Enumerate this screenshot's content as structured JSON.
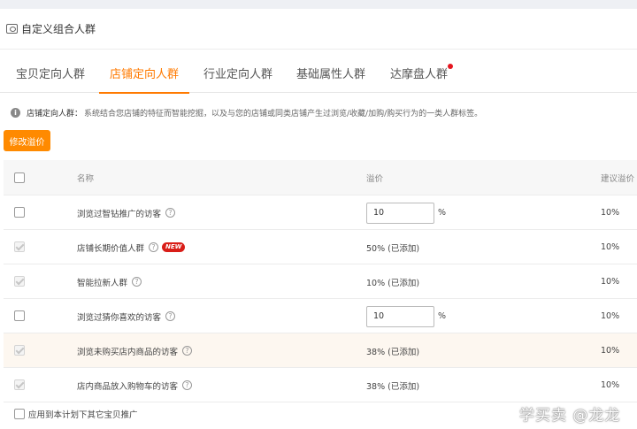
{
  "header": {
    "title": "自定义组合人群",
    "icon": "user-group-icon"
  },
  "tabs": [
    {
      "label": "宝贝定向人群",
      "active": false
    },
    {
      "label": "店铺定向人群",
      "active": true
    },
    {
      "label": "行业定向人群",
      "active": false
    },
    {
      "label": "基础属性人群",
      "active": false
    },
    {
      "label": "达摩盘人群",
      "active": false,
      "has_dot": true
    }
  ],
  "notice": {
    "title": "店铺定向人群：",
    "text": "系统结合您店铺的特征而智能挖掘，以及与您的店铺或同类店铺产生过浏览/收藏/加购/购买行为的一类人群标签。"
  },
  "toolbar": {
    "modify_bid_label": "修改溢价"
  },
  "table": {
    "columns": {
      "name": "名称",
      "bid": "溢价",
      "suggested": "建议溢价"
    },
    "rows": [
      {
        "name": "浏览过智钻推广的访客",
        "help": "?",
        "bid_input": "10",
        "unit": "%",
        "suggested": "10%"
      },
      {
        "name": "店铺长期价值人群",
        "help": "?",
        "badge": "NEW",
        "bid_text": "50% (已添加)",
        "suggested": "10%"
      },
      {
        "name": "智能拉新人群",
        "help": "?",
        "bid_text": "10% (已添加)",
        "suggested": "10%"
      },
      {
        "name": "浏览过猜你喜欢的访客",
        "help": "?",
        "bid_input": "10",
        "unit": "%",
        "suggested": "10%"
      },
      {
        "name": "浏览未购买店内商品的访客",
        "help": "?",
        "bid_text": "38% (已添加)",
        "suggested": "10%"
      },
      {
        "name": "店内商品放入购物车的访客",
        "help": "?",
        "bid_text": "38% (已添加)",
        "suggested": "10%"
      }
    ]
  },
  "footer": {
    "apply_label": "应用到本计划下其它宝贝推广"
  },
  "watermark": "学买卖 @龙龙",
  "colors": {
    "accent": "#ff7a00",
    "button": "#ff8a00",
    "badge": "#d91e18"
  }
}
